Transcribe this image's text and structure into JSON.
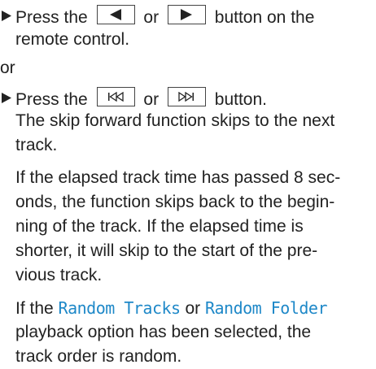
{
  "step1": {
    "prefix": "Press the",
    "or": "or",
    "suffix": "button on the",
    "line2": "remote control.",
    "key_left_icon": "triangle-left-icon",
    "key_right_icon": "triangle-right-icon"
  },
  "separator": "or",
  "step2": {
    "prefix": "Press the",
    "or": "or",
    "suffix": "button.",
    "key_prev_icon": "skip-back-icon",
    "key_next_icon": "skip-forward-icon",
    "explain_line1": "The skip forward function skips to the next",
    "explain_line2": "track."
  },
  "para1": {
    "lines": [
      "If the elapsed track time has passed 8 sec-",
      "onds, the function skips back to the begin-",
      "ning of the track. If the elapsed time is",
      "shorter, it will skip to the start of the pre-",
      "vious track."
    ]
  },
  "para2": {
    "pre": "If the",
    "option1": "Random Tracks",
    "mid": "or",
    "option2": "Random Folder",
    "line2": "playback option has been selected, the",
    "line3": "track order is random."
  },
  "colors": {
    "text": "#222222",
    "highlight": "#1e88c8"
  }
}
